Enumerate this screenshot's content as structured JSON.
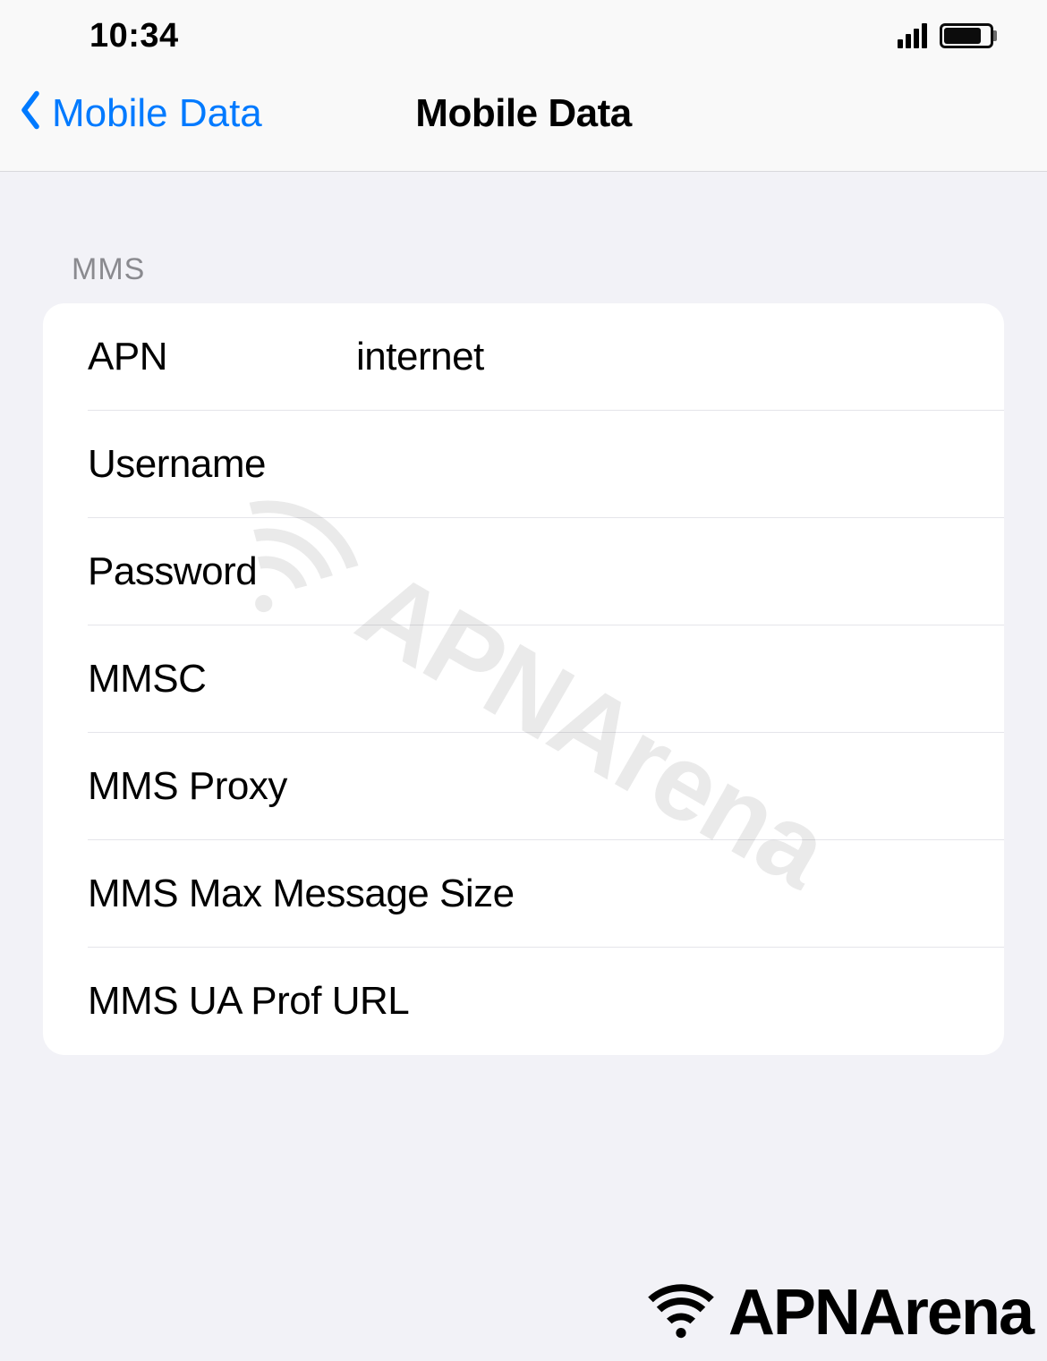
{
  "status_bar": {
    "time": "10:34"
  },
  "nav": {
    "back_label": "Mobile Data",
    "title": "Mobile Data"
  },
  "section_header": "MMS",
  "fields": {
    "apn": {
      "label": "APN",
      "value": "internet"
    },
    "username": {
      "label": "Username",
      "value": ""
    },
    "password": {
      "label": "Password",
      "value": ""
    },
    "mmsc": {
      "label": "MMSC",
      "value": ""
    },
    "mms_proxy": {
      "label": "MMS Proxy",
      "value": ""
    },
    "mms_max_size": {
      "label": "MMS Max Message Size",
      "value": ""
    },
    "mms_ua_prof": {
      "label": "MMS UA Prof URL",
      "value": ""
    }
  },
  "brand": {
    "name": "APNArena"
  }
}
